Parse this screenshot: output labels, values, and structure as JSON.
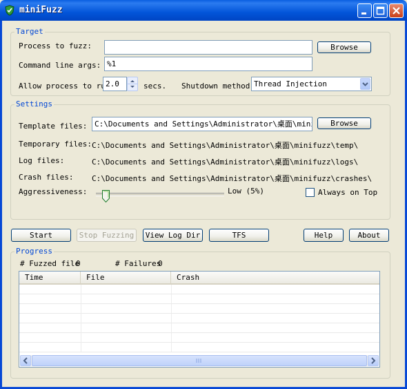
{
  "window": {
    "title": "miniFuzz",
    "controls": [
      "minimize-icon",
      "maximize-icon",
      "close-icon"
    ]
  },
  "target": {
    "legend": "Target",
    "process_label": "Process to fuzz:",
    "process_value": "",
    "browse_label": "Browse",
    "cmdline_label": "Command line args:",
    "cmdline_value": "%1",
    "allow_label": "Allow process to run",
    "allow_value": "2.0",
    "secs_label": "secs.",
    "shutdown_label": "Shutdown method:",
    "shutdown_value": "Thread Injection"
  },
  "settings": {
    "legend": "Settings",
    "template_label": "Template files:",
    "template_value": "C:\\Documents and Settings\\Administrator\\桌面\\minifuzz",
    "browse_label": "Browse",
    "temp_label": "Temporary files:",
    "temp_value": "C:\\Documents and Settings\\Administrator\\桌面\\minifuzz\\temp\\",
    "log_label": "Log files:",
    "log_value": "C:\\Documents and Settings\\Administrator\\桌面\\minifuzz\\logs\\",
    "crash_label": "Crash files:",
    "crash_value": "C:\\Documents and Settings\\Administrator\\桌面\\minifuzz\\crashes\\",
    "aggr_label": "Aggressiveness:",
    "aggr_value_text": "Low  (5%)",
    "aggr_level": 0.05,
    "always_on_top_label": "Always on Top",
    "always_on_top_checked": false
  },
  "buttons": {
    "start": "Start",
    "stop": "Stop Fuzzing",
    "view_log": "View Log Dir",
    "tfs": "TFS",
    "help": "Help",
    "about": "About"
  },
  "progress": {
    "legend": "Progress",
    "fuzzed_label": "# Fuzzed file",
    "fuzzed_value": "0",
    "failures_label": "# Failures",
    "failures_value": "0",
    "columns": [
      "Time",
      "File",
      "Crash"
    ],
    "rows": []
  },
  "colors": {
    "titlebar": "#0255d9",
    "legend_text": "#0046d5",
    "dialog_bg": "#ece9d8"
  }
}
